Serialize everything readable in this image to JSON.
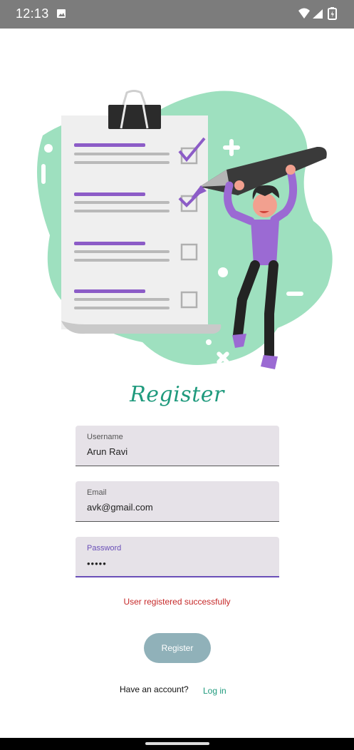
{
  "status_bar": {
    "time": "12:13",
    "icons": [
      "image-icon",
      "wifi-icon",
      "signal-icon",
      "battery-charging-icon"
    ]
  },
  "form": {
    "title": "Register",
    "username": {
      "label": "Username",
      "value": "Arun Ravi"
    },
    "email": {
      "label": "Email",
      "value": "avk@gmail.com"
    },
    "password": {
      "label": "Password",
      "value": "•••••"
    },
    "status_message": "User registered successfully",
    "register_label": "Register",
    "have_account_text": "Have an account?",
    "login_label": "Log in"
  },
  "colors": {
    "accent_green": "#1f9a7d",
    "blob_green": "#9ee0bf",
    "purple": "#8c5cc7",
    "error_red": "#c62828",
    "button_bg": "#90b1b9"
  }
}
